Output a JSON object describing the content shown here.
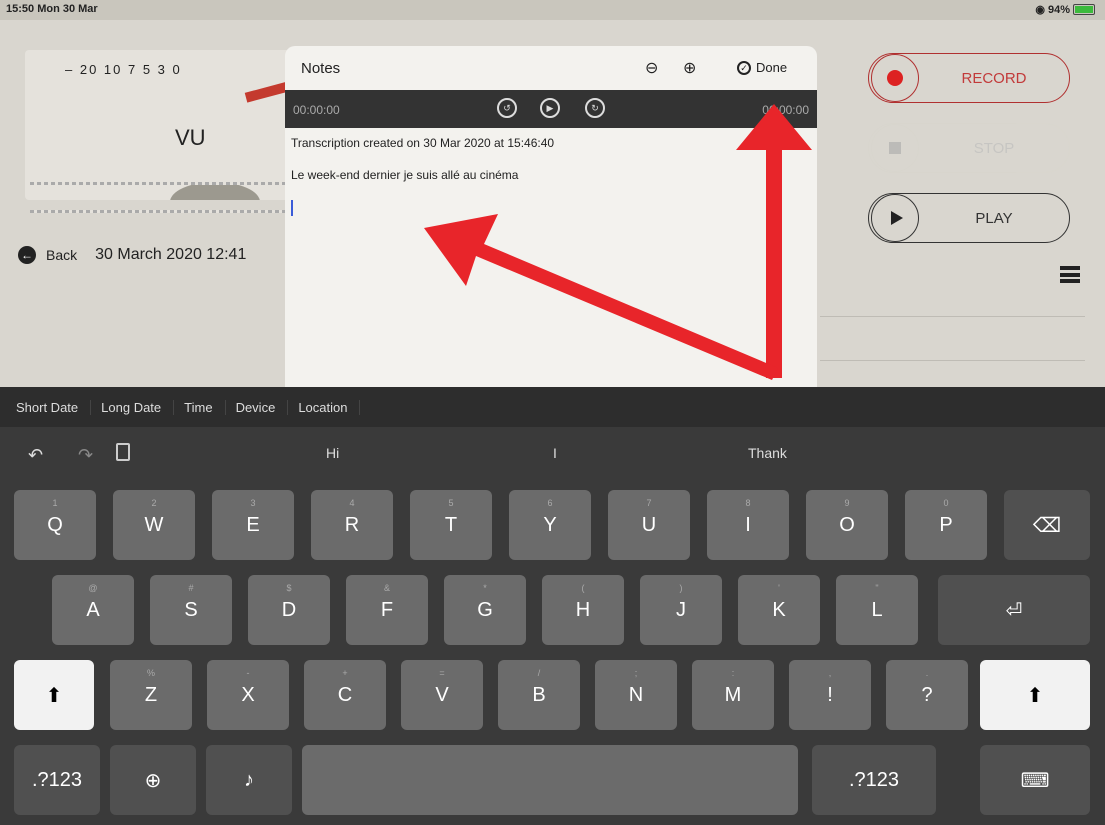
{
  "status": {
    "time": "15:50  Mon 30 Mar",
    "battery": "94%"
  },
  "app": {
    "vu_scale": "– 20  10  7  5  3  0",
    "vu_label": "VU",
    "back_label": "Back",
    "date_title": "30 March 2020 12:41",
    "record_label": "RECORD",
    "stop_label": "STOP",
    "play_label": "PLAY"
  },
  "notes": {
    "title": "Notes",
    "done_label": "Done",
    "time_start": "00:00:00",
    "time_end": "00:00:00",
    "line1": "Transcription created on 30 Mar 2020 at 15:46:40",
    "line2": "Le week-end dernier je suis allé au cinéma"
  },
  "keyboard": {
    "shortcuts": [
      "Short Date",
      "Long Date",
      "Time",
      "Device",
      "Location"
    ],
    "predictions": [
      "Hi",
      "I",
      "Thank"
    ],
    "row1": [
      "Q",
      "W",
      "E",
      "R",
      "T",
      "Y",
      "U",
      "I",
      "O",
      "P"
    ],
    "row1_sub": [
      "1",
      "2",
      "3",
      "4",
      "5",
      "6",
      "7",
      "8",
      "9",
      "0"
    ],
    "row2": [
      "A",
      "S",
      "D",
      "F",
      "G",
      "H",
      "J",
      "K",
      "L"
    ],
    "row2_sub": [
      "@",
      "#",
      "$",
      "&",
      "*",
      "(",
      ")",
      "'",
      "\""
    ],
    "row3": [
      "Z",
      "X",
      "C",
      "V",
      "B",
      "N",
      "M",
      "!",
      "?"
    ],
    "row3_sub": [
      "%",
      "-",
      "+",
      "=",
      "/",
      ";",
      ":",
      ",",
      "."
    ],
    "num_label": ".?123",
    "num_label_right": ".?123"
  },
  "colors": {
    "accent_red": "#e8252a",
    "record": "#d22222"
  }
}
